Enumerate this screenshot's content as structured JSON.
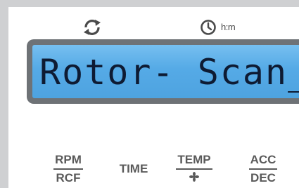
{
  "icons": {
    "refresh": "refresh-icon",
    "clock": "clock-icon",
    "fan": "fan-icon"
  },
  "clock_label": "h:m",
  "display": {
    "text": "Rotor- Scan_",
    "colors": {
      "frame": "#6e7276",
      "screen": "#55aae6",
      "segments": "#0e1b33"
    }
  },
  "buttons": {
    "rpm_rcf": {
      "top": "RPM",
      "bottom": "RCF"
    },
    "time": {
      "label": "TIME"
    },
    "temp": {
      "top": "TEMP",
      "icon": "fan-icon"
    },
    "acc_dec": {
      "top": "ACC",
      "bottom": "DEC"
    }
  }
}
